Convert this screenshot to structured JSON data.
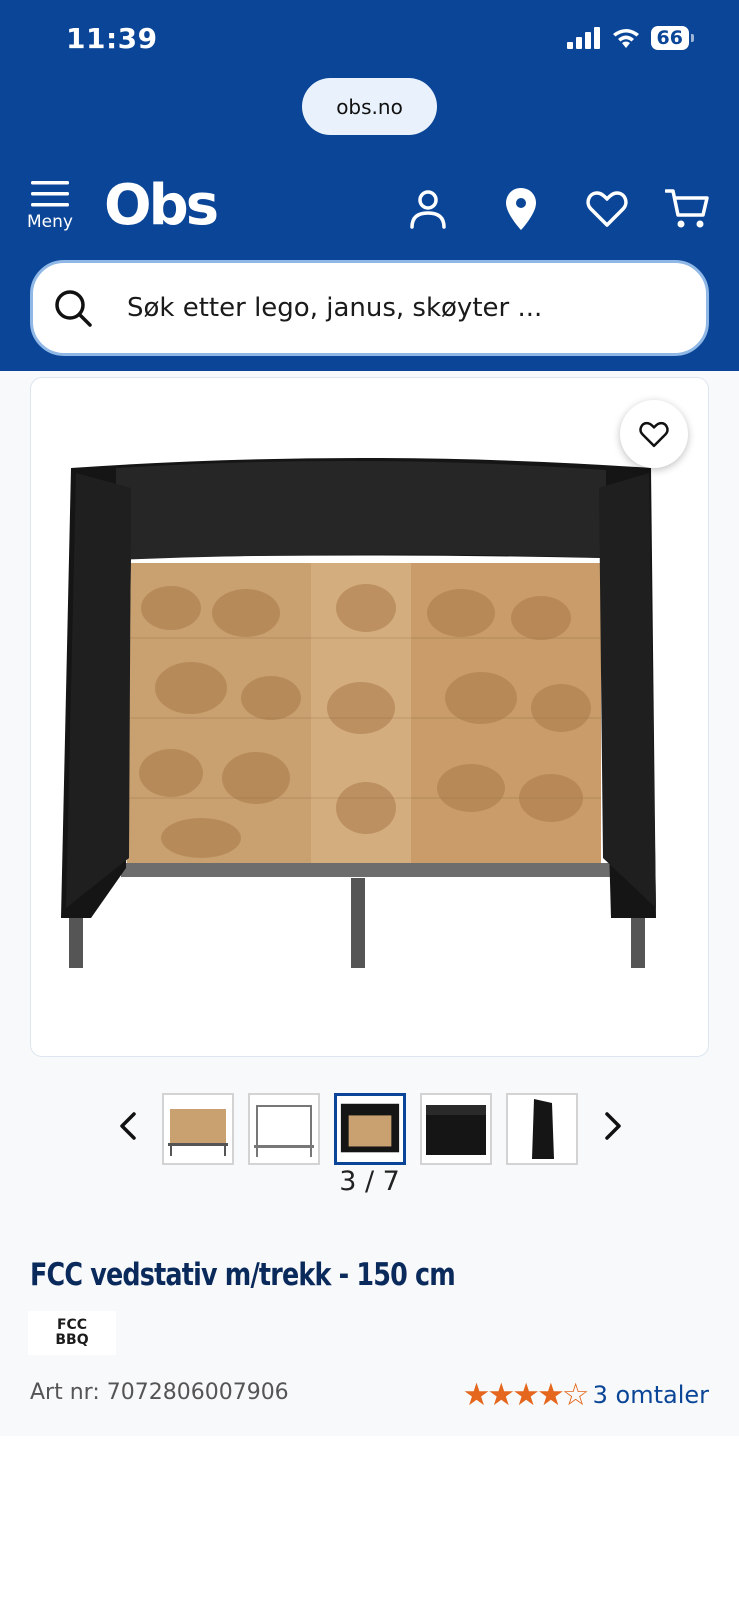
{
  "status_bar": {
    "time": "11:39",
    "battery": "66"
  },
  "browser": {
    "url": "obs.no"
  },
  "nav": {
    "menu_label": "Meny",
    "logo_text": "Obs"
  },
  "search": {
    "placeholder": "Søk etter lego, janus, skøyter ..."
  },
  "gallery": {
    "counter": "3 / 7",
    "thumbnails": [
      "firewood-rack",
      "empty-rack",
      "rack-with-cover-open",
      "rack-with-cover-closed",
      "cover-side-view"
    ],
    "active_index": 3
  },
  "product": {
    "title": "FCC vedstativ m/trekk - 150 cm",
    "brand_line1": "FCC",
    "brand_line2": "BBQ",
    "art_nr": "Art nr: 7072806007906",
    "rating": 4.5,
    "stars_text": "★★★★☆",
    "reviews_label": "3 omtaler"
  },
  "colors": {
    "brand_blue": "#0a4597",
    "star_orange": "#e4671d",
    "title_navy": "#0b2a5c"
  }
}
